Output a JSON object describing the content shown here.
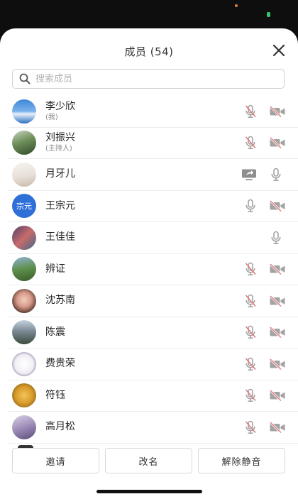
{
  "header": {
    "title": "成员 (54)"
  },
  "search": {
    "placeholder": "搜索成员"
  },
  "members": [
    {
      "name": "李少欣",
      "sub": "(我)",
      "mic": "muted",
      "cam": "off",
      "avatar": "sky-photo"
    },
    {
      "name": "刘振兴",
      "sub": "(主持人)",
      "mic": "muted",
      "cam": "off",
      "avatar": "landscape-photo"
    },
    {
      "name": "月牙儿",
      "sub": "",
      "share": true,
      "mic": "on",
      "cam": "none",
      "avatar": "room-photo"
    },
    {
      "name": "王宗元",
      "sub": "",
      "mic": "on",
      "cam": "off",
      "avatar": "text",
      "avatar_text": "宗元"
    },
    {
      "name": "王佳佳",
      "sub": "",
      "mic": "on",
      "cam": "none",
      "avatar": "people-photo"
    },
    {
      "name": "辨证",
      "sub": "",
      "mic": "muted",
      "cam": "off",
      "avatar": "nature-photo"
    },
    {
      "name": "沈苏南",
      "sub": "",
      "mic": "muted",
      "cam": "off",
      "avatar": "child-photo"
    },
    {
      "name": "陈震",
      "sub": "",
      "mic": "muted",
      "cam": "off",
      "avatar": "mountain-photo"
    },
    {
      "name": "费贵荣",
      "sub": "",
      "mic": "muted",
      "cam": "off",
      "avatar": "cartoon-photo"
    },
    {
      "name": "符钰",
      "sub": "",
      "mic": "muted",
      "cam": "off",
      "avatar": "dog-photo"
    },
    {
      "name": "高月松",
      "sub": "",
      "mic": "muted",
      "cam": "off",
      "avatar": "person-photo"
    }
  ],
  "footer": {
    "invite_label": "邀请",
    "rename_label": "改名",
    "unmute_label": "解除静音"
  },
  "colors": {
    "icon_gray": "#9a9a9a",
    "mute_slash": "#e26a6a",
    "avatar_blue": "#2f6fd8"
  }
}
